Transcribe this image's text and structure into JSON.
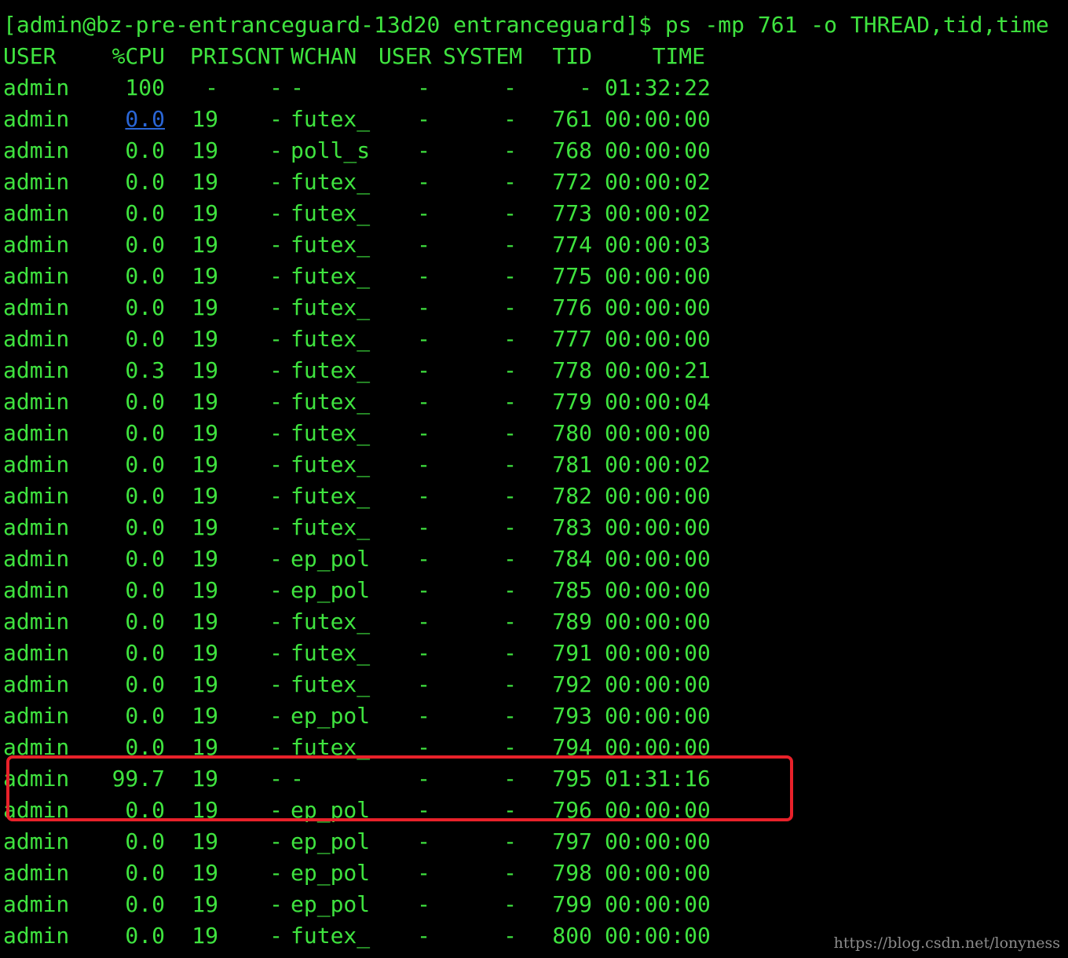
{
  "terminal": {
    "prompt_line": "[admin@bz-pre-entranceguard-13d20 entranceguard]$ ps -mp 761 -o THREAD,tid,time",
    "columns": [
      "USER",
      "%CPU",
      "PRI",
      "SCNT",
      "WCHAN",
      "USER",
      "SYSTEM",
      "TID",
      "TIME"
    ],
    "rows": [
      {
        "user": "admin",
        "cpu": "100",
        "pri": "-",
        "scnt": "-",
        "wchan": "-",
        "usr": "-",
        "sys": "-",
        "tid": "-",
        "time": "01:32:22"
      },
      {
        "user": "admin",
        "cpu": "0.0",
        "pri": "19",
        "scnt": "-",
        "wchan": "futex_",
        "usr": "-",
        "sys": "-",
        "tid": "761",
        "time": "00:00:00"
      },
      {
        "user": "admin",
        "cpu": "0.0",
        "pri": "19",
        "scnt": "-",
        "wchan": "poll_s",
        "usr": "-",
        "sys": "-",
        "tid": "768",
        "time": "00:00:00"
      },
      {
        "user": "admin",
        "cpu": "0.0",
        "pri": "19",
        "scnt": "-",
        "wchan": "futex_",
        "usr": "-",
        "sys": "-",
        "tid": "772",
        "time": "00:00:02"
      },
      {
        "user": "admin",
        "cpu": "0.0",
        "pri": "19",
        "scnt": "-",
        "wchan": "futex_",
        "usr": "-",
        "sys": "-",
        "tid": "773",
        "time": "00:00:02"
      },
      {
        "user": "admin",
        "cpu": "0.0",
        "pri": "19",
        "scnt": "-",
        "wchan": "futex_",
        "usr": "-",
        "sys": "-",
        "tid": "774",
        "time": "00:00:03"
      },
      {
        "user": "admin",
        "cpu": "0.0",
        "pri": "19",
        "scnt": "-",
        "wchan": "futex_",
        "usr": "-",
        "sys": "-",
        "tid": "775",
        "time": "00:00:00"
      },
      {
        "user": "admin",
        "cpu": "0.0",
        "pri": "19",
        "scnt": "-",
        "wchan": "futex_",
        "usr": "-",
        "sys": "-",
        "tid": "776",
        "time": "00:00:00"
      },
      {
        "user": "admin",
        "cpu": "0.0",
        "pri": "19",
        "scnt": "-",
        "wchan": "futex_",
        "usr": "-",
        "sys": "-",
        "tid": "777",
        "time": "00:00:00"
      },
      {
        "user": "admin",
        "cpu": "0.3",
        "pri": "19",
        "scnt": "-",
        "wchan": "futex_",
        "usr": "-",
        "sys": "-",
        "tid": "778",
        "time": "00:00:21"
      },
      {
        "user": "admin",
        "cpu": "0.0",
        "pri": "19",
        "scnt": "-",
        "wchan": "futex_",
        "usr": "-",
        "sys": "-",
        "tid": "779",
        "time": "00:00:04"
      },
      {
        "user": "admin",
        "cpu": "0.0",
        "pri": "19",
        "scnt": "-",
        "wchan": "futex_",
        "usr": "-",
        "sys": "-",
        "tid": "780",
        "time": "00:00:00"
      },
      {
        "user": "admin",
        "cpu": "0.0",
        "pri": "19",
        "scnt": "-",
        "wchan": "futex_",
        "usr": "-",
        "sys": "-",
        "tid": "781",
        "time": "00:00:02"
      },
      {
        "user": "admin",
        "cpu": "0.0",
        "pri": "19",
        "scnt": "-",
        "wchan": "futex_",
        "usr": "-",
        "sys": "-",
        "tid": "782",
        "time": "00:00:00"
      },
      {
        "user": "admin",
        "cpu": "0.0",
        "pri": "19",
        "scnt": "-",
        "wchan": "futex_",
        "usr": "-",
        "sys": "-",
        "tid": "783",
        "time": "00:00:00"
      },
      {
        "user": "admin",
        "cpu": "0.0",
        "pri": "19",
        "scnt": "-",
        "wchan": "ep_pol",
        "usr": "-",
        "sys": "-",
        "tid": "784",
        "time": "00:00:00"
      },
      {
        "user": "admin",
        "cpu": "0.0",
        "pri": "19",
        "scnt": "-",
        "wchan": "ep_pol",
        "usr": "-",
        "sys": "-",
        "tid": "785",
        "time": "00:00:00"
      },
      {
        "user": "admin",
        "cpu": "0.0",
        "pri": "19",
        "scnt": "-",
        "wchan": "futex_",
        "usr": "-",
        "sys": "-",
        "tid": "789",
        "time": "00:00:00"
      },
      {
        "user": "admin",
        "cpu": "0.0",
        "pri": "19",
        "scnt": "-",
        "wchan": "futex_",
        "usr": "-",
        "sys": "-",
        "tid": "791",
        "time": "00:00:00"
      },
      {
        "user": "admin",
        "cpu": "0.0",
        "pri": "19",
        "scnt": "-",
        "wchan": "futex_",
        "usr": "-",
        "sys": "-",
        "tid": "792",
        "time": "00:00:00"
      },
      {
        "user": "admin",
        "cpu": "0.0",
        "pri": "19",
        "scnt": "-",
        "wchan": "ep_pol",
        "usr": "-",
        "sys": "-",
        "tid": "793",
        "time": "00:00:00"
      },
      {
        "user": "admin",
        "cpu": "0.0",
        "pri": "19",
        "scnt": "-",
        "wchan": "futex_",
        "usr": "-",
        "sys": "-",
        "tid": "794",
        "time": "00:00:00"
      },
      {
        "user": "admin",
        "cpu": "99.7",
        "pri": "19",
        "scnt": "-",
        "wchan": "-",
        "usr": "-",
        "sys": "-",
        "tid": "795",
        "time": "01:31:16"
      },
      {
        "user": "admin",
        "cpu": "0.0",
        "pri": "19",
        "scnt": "-",
        "wchan": "ep_pol",
        "usr": "-",
        "sys": "-",
        "tid": "796",
        "time": "00:00:00"
      },
      {
        "user": "admin",
        "cpu": "0.0",
        "pri": "19",
        "scnt": "-",
        "wchan": "ep_pol",
        "usr": "-",
        "sys": "-",
        "tid": "797",
        "time": "00:00:00"
      },
      {
        "user": "admin",
        "cpu": "0.0",
        "pri": "19",
        "scnt": "-",
        "wchan": "ep_pol",
        "usr": "-",
        "sys": "-",
        "tid": "798",
        "time": "00:00:00"
      },
      {
        "user": "admin",
        "cpu": "0.0",
        "pri": "19",
        "scnt": "-",
        "wchan": "ep_pol",
        "usr": "-",
        "sys": "-",
        "tid": "799",
        "time": "00:00:00"
      },
      {
        "user": "admin",
        "cpu": "0.0",
        "pri": "19",
        "scnt": "-",
        "wchan": "futex_",
        "usr": "-",
        "sys": "-",
        "tid": "800",
        "time": "00:00:00"
      }
    ],
    "highlighted_tids": [
      "795",
      "796"
    ],
    "linked_row_index": 1
  },
  "watermark": "https://blog.csdn.net/lonyness",
  "colors": {
    "background": "#000000",
    "text": "#3fe33f",
    "link": "#2a66d6",
    "highlight_border": "#e8212a",
    "watermark": "#8c8c8c"
  }
}
